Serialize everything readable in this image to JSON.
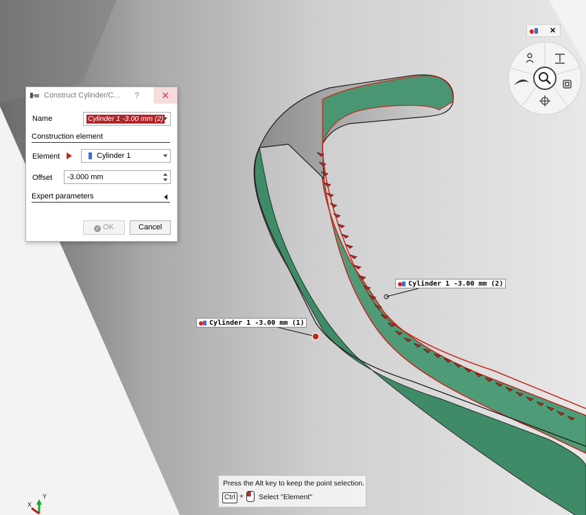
{
  "dialog": {
    "title": "Construct Cylinder/C...",
    "help": "?",
    "close": "✕",
    "name_label": "Name",
    "name_value": "Cylinder 1 -3.00 mm (2)",
    "section_construction": "Construction element",
    "element_label": "Element",
    "element_value": "Cylinder 1",
    "offset_label": "Offset",
    "offset_value": "-3.000 mm",
    "expert_label": "Expert parameters",
    "ok_label": "OK",
    "cancel_label": "Cancel"
  },
  "toolbox": {
    "close": "✕"
  },
  "viewport": {
    "label1": "Cylinder 1 -3.00 mm (1)",
    "label2": "Cylinder 1 -3.00 mm (2)",
    "axis_x": "X",
    "axis_y": "Y"
  },
  "hint": {
    "line1": "Press the Alt key to keep the point selection.",
    "key_ctrl": "Ctrl",
    "plus": "+",
    "action": "Select \"Element\""
  },
  "colors": {
    "green_surface": "#3d8a66",
    "red_arrow": "#c0281f",
    "selection": "#b22328"
  }
}
